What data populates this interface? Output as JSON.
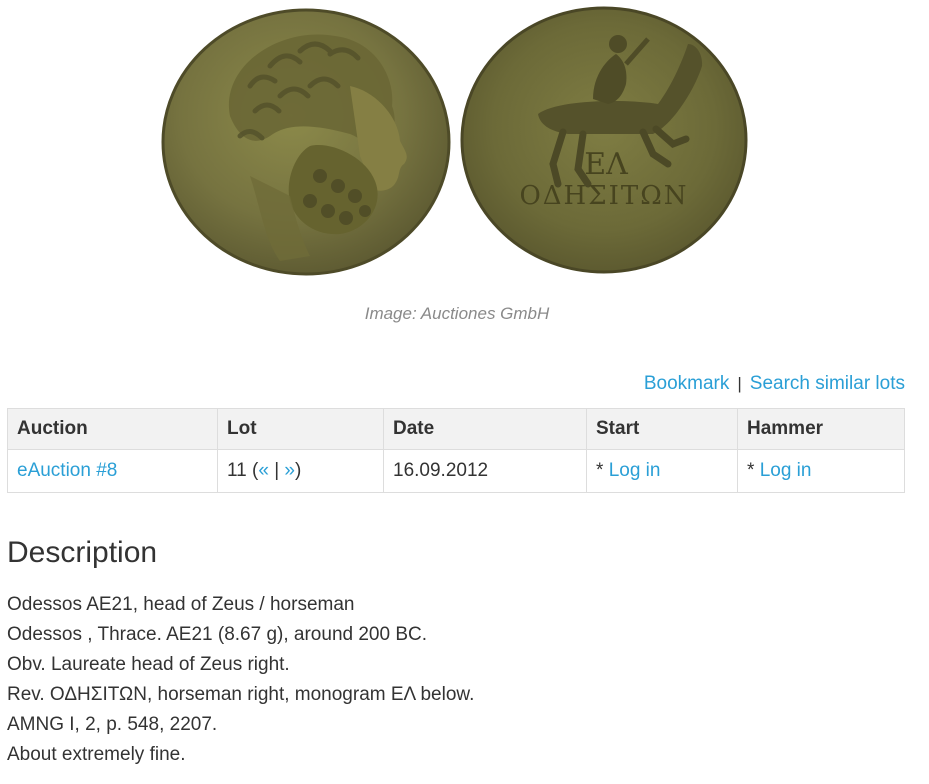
{
  "image": {
    "caption": "Image: Auctiones GmbH",
    "obverse_legend": "",
    "reverse_monogram": "ΕΛ",
    "reverse_legend": "ΟΔΗΣΙΤΩΝ"
  },
  "actions": {
    "bookmark": "Bookmark",
    "separator": "|",
    "search_similar": "Search similar lots"
  },
  "table": {
    "headers": [
      "Auction",
      "Lot",
      "Date",
      "Start",
      "Hammer"
    ],
    "row": {
      "auction": "eAuction #8",
      "lot_number": "11 (",
      "lot_prev": "«",
      "lot_sep": " | ",
      "lot_next": "»",
      "lot_close": ")",
      "date": "16.09.2012",
      "start_prefix": "* ",
      "start_link": "Log in",
      "hammer_prefix": "* ",
      "hammer_link": "Log in"
    }
  },
  "description": {
    "title": "Description",
    "lines": [
      "Odessos AE21, head of Zeus / horseman",
      "Odessos , Thrace. AE21 (8.67 g), around 200 BC.",
      "Obv. Laureate head of Zeus right.",
      "Rev. ΟΔΗΣΙΤΩΝ, horseman right, monogram ΕΛ below.",
      "AMNG I, 2, p. 548, 2207.",
      "About extremely fine."
    ]
  },
  "colors": {
    "link": "#2a9fd6",
    "text": "#333333",
    "caption": "#8a8a8a",
    "table_header_bg": "#f2f2f2",
    "coin_bronze": "#7f7a3c"
  }
}
